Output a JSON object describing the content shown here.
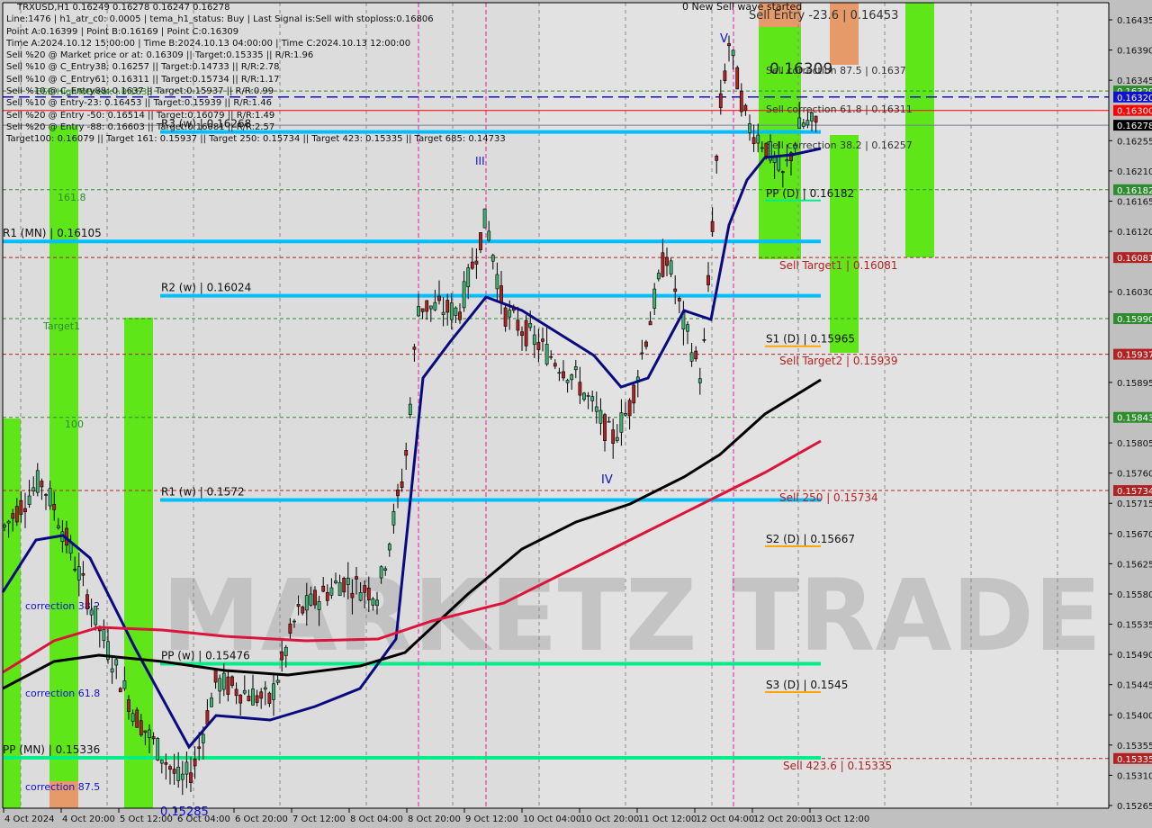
{
  "chart_data": {
    "type": "candlestick",
    "symbol": "TRXUSD",
    "timeframe": "H1",
    "ohlc_header": {
      "open": 0.16249,
      "high": 0.16278,
      "low": 0.16247,
      "close": 0.16278
    },
    "info_lines": [
      "TRXUSD,H1  0.16249 0.16278 0.16247 0.16278",
      "Line:1476 | h1_atr_c0: 0.0005 | tema_h1_status: Buy | Last Signal is:Sell with stoploss:0.16806",
      "Point A:0.16399 | Point B:0.16169 | Point C:0.16309",
      "Time A:2024.10.12 15:00:00 | Time B:2024.10.13 04:00:00 | Time C:2024.10.13 12:00:00",
      "Sell %20 @ Market price or at: 0.16309 || Target:0.15335 || R/R:1.96",
      "Sell %10 @ C_Entry38: 0.16257 || Target:0.14733 || R/R:2.78",
      "Sell %10 @ C_Entry61: 0.16311 || Target:0.15734 || R/R:1.17",
      "Sell %10 @ C_Entry88: 0.1637 || Target:0.15937 || R/R:0.99",
      "Sell %10 @ Entry-23: 0.16453 || Target:0.15939 || R/R:1.46",
      "Sell %20 @ Entry -50: 0.16514 || Target:0.16079 || R/R:1.49",
      "Sell %20 @ Entry -88: 0.16603 || Target:0.16081 || R/R:2.57",
      "Target100: 0.16079 || Target 161: 0.15937 || Target 250: 0.15734 || Target 423: 0.15335 || Target 685: 0.14733"
    ],
    "y_axis": {
      "range": [
        0.15265,
        0.1646
      ],
      "ticks": [
        "0.16435",
        "0.16390",
        "0.16345",
        "0.16255",
        "0.16210",
        "0.16165",
        "0.16120",
        "0.16030",
        "0.15895",
        "0.15805",
        "0.15760",
        "0.15715",
        "0.15670",
        "0.15625",
        "0.15580",
        "0.15535",
        "0.15490",
        "0.15445",
        "0.15400",
        "0.15355",
        "0.15310",
        "0.15265"
      ],
      "price_tags": [
        {
          "value": "0.16329",
          "color": "#2e8b2e"
        },
        {
          "value": "0.16320",
          "color": "#1010d0"
        },
        {
          "value": "0.16300",
          "color": "#ff0000"
        },
        {
          "value": "0.16278",
          "color": "#000000"
        },
        {
          "value": "0.16182",
          "color": "#2e8b2e"
        },
        {
          "value": "0.16081",
          "color": "#b22222"
        },
        {
          "value": "0.15990",
          "color": "#2e8b2e"
        },
        {
          "value": "0.15937",
          "color": "#b22222"
        },
        {
          "value": "0.15843",
          "color": "#2e8b2e"
        },
        {
          "value": "0.15734",
          "color": "#b22222"
        },
        {
          "value": "0.15335",
          "color": "#b22222"
        }
      ]
    },
    "x_axis": {
      "ticks": [
        "4 Oct 2024",
        "4 Oct 20:00",
        "5 Oct 12:00",
        "6 Oct 04:00",
        "6 Oct 20:00",
        "7 Oct 12:00",
        "8 Oct 04:00",
        "8 Oct 20:00",
        "9 Oct 12:00",
        "10 Oct 04:00",
        "10 Oct 20:00",
        "11 Oct 12:00",
        "12 Oct 04:00",
        "12 Oct 20:00",
        "13 Oct 12:00"
      ]
    },
    "pivot_lines": [
      {
        "label": "R1 (MN) | 0.16105",
        "value": 0.16105,
        "color": "#00bfff"
      },
      {
        "label": "R2 (w) | 0.16024",
        "value": 0.16024,
        "color": "#00bfff"
      },
      {
        "label": "R3 (w) | 0.16268",
        "value": 0.16268,
        "color": "#00bfff"
      },
      {
        "label": "R1 (w) | 0.1572",
        "value": 0.1572,
        "color": "#00bfff"
      },
      {
        "label": "PP (w) | 0.15476",
        "value": 0.15476,
        "color": "#00ee88"
      },
      {
        "label": "PP (MN) | 0.15336",
        "value": 0.15336,
        "color": "#00ee88"
      },
      {
        "label": "PP (D) | 0.16182",
        "value": 0.16182,
        "color": "#00ee88"
      },
      {
        "label": "S1 (D) | 0.15965",
        "value": 0.15965,
        "color": "#ffa500"
      },
      {
        "label": "S2 (D) | 0.15667",
        "value": 0.15667,
        "color": "#ffa500"
      },
      {
        "label": "S3 (D) | 0.1545",
        "value": 0.1545,
        "color": "#ffa500"
      }
    ],
    "sell_levels": [
      {
        "label": "Sell Entry -23.6 | 0.16453",
        "value": 0.16453
      },
      {
        "label": "Sell correction 87.5 | 0.1637",
        "value": 0.1637
      },
      {
        "label": "Sell correction 61.8 | 0.16311",
        "value": 0.16311
      },
      {
        "label": "Sell correction 38.2 | 0.16257",
        "value": 0.16257
      },
      {
        "label": "Sell Target1 | 0.16081",
        "value": 0.16081
      },
      {
        "label": "Sell Target2 | 0.15939",
        "value": 0.15939
      },
      {
        "label": "Sell 250 | 0.15734",
        "value": 0.15734
      },
      {
        "label": "Sell 423.6 | 0.15335",
        "value": 0.15335
      }
    ],
    "annotations": [
      {
        "text": "0 New Sell wave started"
      },
      {
        "text": "0.16309"
      },
      {
        "text": "V"
      },
      {
        "text": "IV"
      },
      {
        "text": "III"
      },
      {
        "text": "161.8"
      },
      {
        "text": "100"
      },
      {
        "text": "Target1"
      },
      {
        "text": "correction 38.2"
      },
      {
        "text": "correction 61.8"
      },
      {
        "text": "correction 87.5"
      },
      {
        "text": "ESB HighToBreak | 0.1633"
      },
      {
        "text": "0.15285"
      }
    ],
    "watermark": "MARKETZ TRADE",
    "ma_series": [
      {
        "name": "EMA fast",
        "color": "#0a0a80"
      },
      {
        "name": "MA slow",
        "color": "#000000"
      },
      {
        "name": "MA 200",
        "color": "#dc143c"
      }
    ]
  }
}
